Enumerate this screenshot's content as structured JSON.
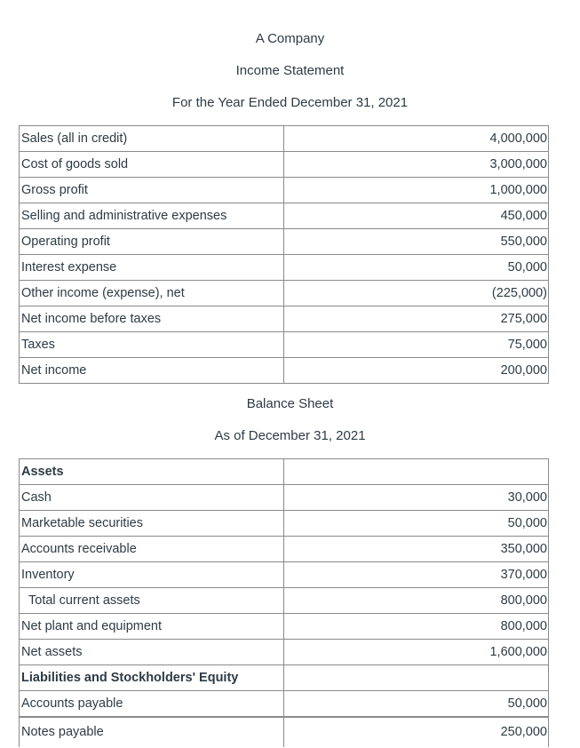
{
  "income_statement": {
    "company": "A Company",
    "title": "Income Statement",
    "period": "For the Year Ended December 31, 2021",
    "rows": [
      {
        "label": "Sales (all in credit)",
        "value": "4,000,000"
      },
      {
        "label": "Cost of goods sold",
        "value": "3,000,000"
      },
      {
        "label": "Gross profit",
        "value": "1,000,000"
      },
      {
        "label": "Selling and administrative expenses",
        "value": "450,000"
      },
      {
        "label": "Operating profit",
        "value": "550,000"
      },
      {
        "label": "Interest expense",
        "value": "50,000"
      },
      {
        "label": "Other income (expense), net",
        "value": "(225,000)"
      },
      {
        "label": "Net income before taxes",
        "value": "275,000"
      },
      {
        "label": "Taxes",
        "value": "75,000"
      },
      {
        "label": "Net income",
        "value": "200,000"
      }
    ]
  },
  "balance_sheet": {
    "title": "Balance Sheet",
    "period": "As of December 31, 2021",
    "rows": [
      {
        "label": "Assets",
        "value": ""
      },
      {
        "label": "Cash",
        "value": "30,000"
      },
      {
        "label": "Marketable securities",
        "value": "50,000"
      },
      {
        "label": "Accounts receivable",
        "value": "350,000"
      },
      {
        "label": "Inventory",
        "value": "370,000"
      },
      {
        "label": "Total current assets",
        "value": "800,000"
      },
      {
        "label": "Net plant and equipment",
        "value": "800,000"
      },
      {
        "label": "Net assets",
        "value": "1,600,000"
      },
      {
        "label": "Liabilities and Stockholders' Equity",
        "value": ""
      },
      {
        "label": "Accounts payable",
        "value": "50,000"
      },
      {
        "label": "Notes payable",
        "value": "250,000"
      }
    ]
  }
}
